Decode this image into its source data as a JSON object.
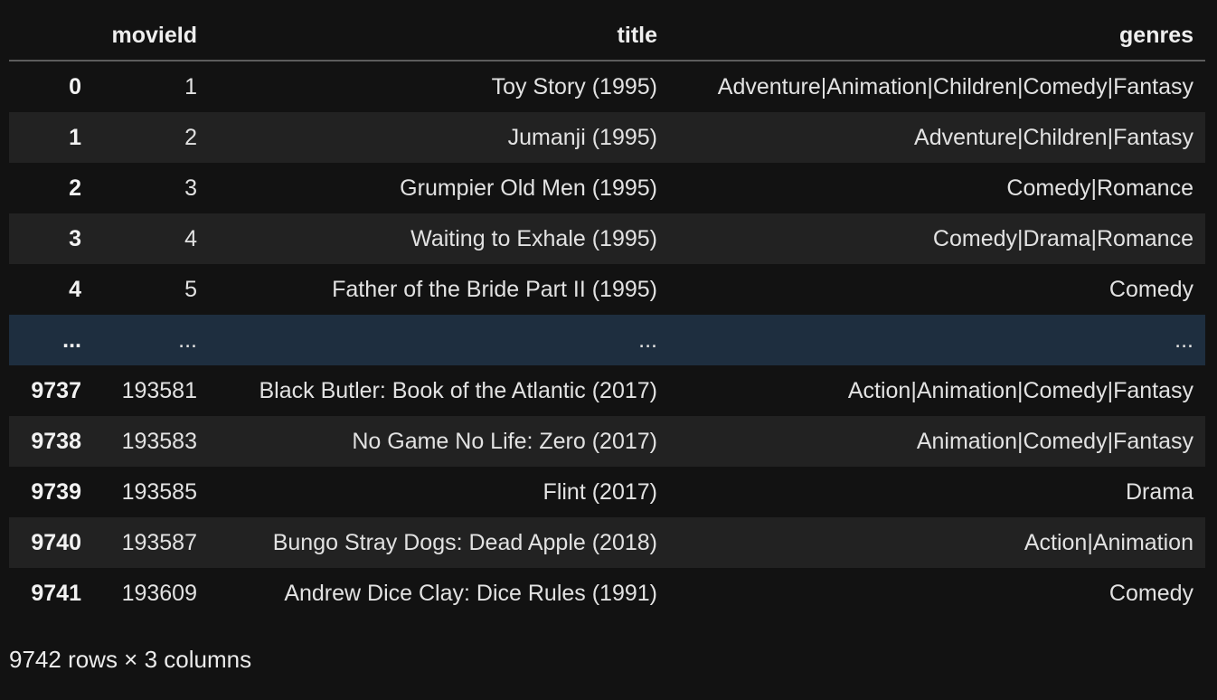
{
  "table": {
    "index_header": "",
    "columns": [
      "movieId",
      "title",
      "genres"
    ],
    "rows": [
      {
        "index": "0",
        "movieId": "1",
        "title": "Toy Story (1995)",
        "genres": "Adventure|Animation|Children|Comedy|Fantasy"
      },
      {
        "index": "1",
        "movieId": "2",
        "title": "Jumanji (1995)",
        "genres": "Adventure|Children|Fantasy"
      },
      {
        "index": "2",
        "movieId": "3",
        "title": "Grumpier Old Men (1995)",
        "genres": "Comedy|Romance"
      },
      {
        "index": "3",
        "movieId": "4",
        "title": "Waiting to Exhale (1995)",
        "genres": "Comedy|Drama|Romance"
      },
      {
        "index": "4",
        "movieId": "5",
        "title": "Father of the Bride Part II (1995)",
        "genres": "Comedy"
      },
      {
        "index": "...",
        "movieId": "...",
        "title": "...",
        "genres": "..."
      },
      {
        "index": "9737",
        "movieId": "193581",
        "title": "Black Butler: Book of the Atlantic (2017)",
        "genres": "Action|Animation|Comedy|Fantasy"
      },
      {
        "index": "9738",
        "movieId": "193583",
        "title": "No Game No Life: Zero (2017)",
        "genres": "Animation|Comedy|Fantasy"
      },
      {
        "index": "9739",
        "movieId": "193585",
        "title": "Flint (2017)",
        "genres": "Drama"
      },
      {
        "index": "9740",
        "movieId": "193587",
        "title": "Bungo Stray Dogs: Dead Apple (2018)",
        "genres": "Action|Animation"
      },
      {
        "index": "9741",
        "movieId": "193609",
        "title": "Andrew Dice Clay: Dice Rules (1991)",
        "genres": "Comedy"
      }
    ]
  },
  "shape_text": "9742 rows × 3 columns",
  "colors": {
    "background": "#121212",
    "row_alt": "#222222",
    "ellipsis_row": "#1e2e3f",
    "header_rule": "#5c5c5c",
    "text": "#e8e8e8"
  }
}
